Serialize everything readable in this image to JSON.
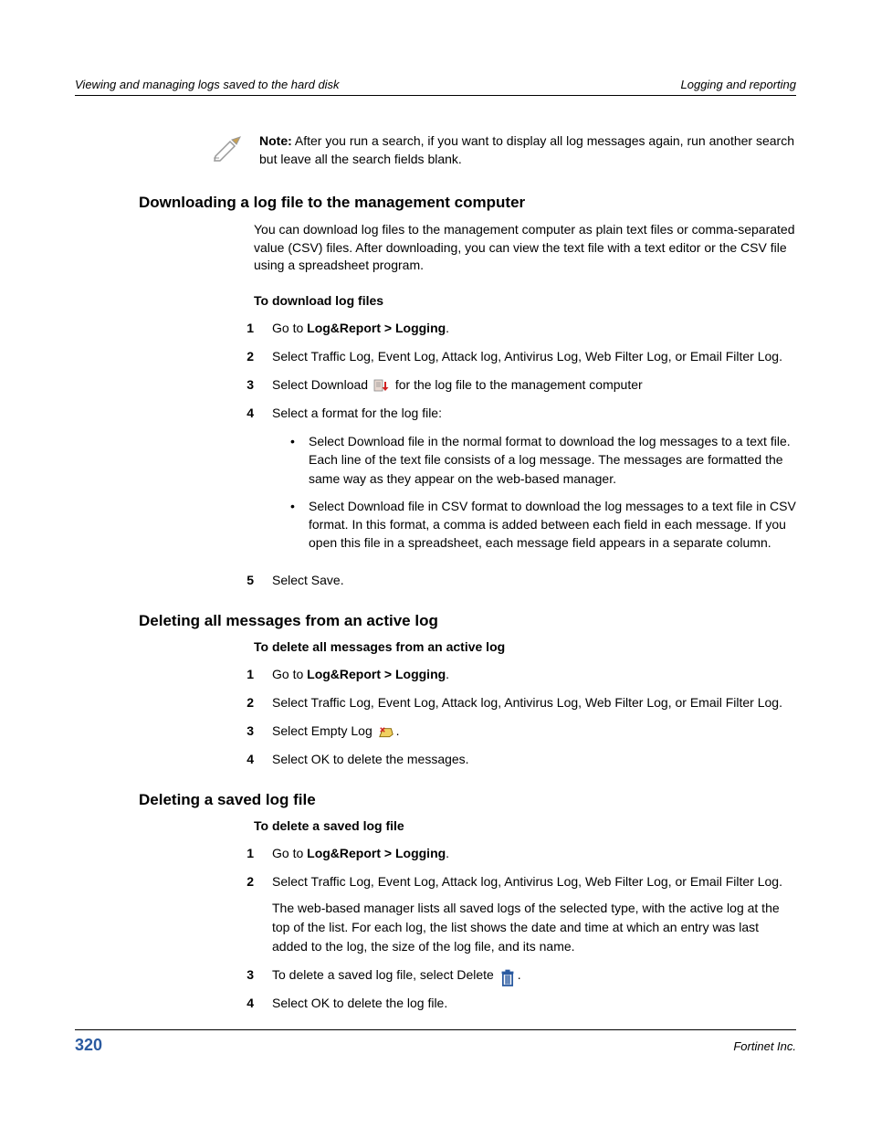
{
  "header": {
    "left": "Viewing and managing logs saved to the hard disk",
    "right": "Logging and reporting"
  },
  "note": {
    "label": "Note:",
    "text": " After you run a search, if you want to display all log messages again, run another search but leave all the search fields blank."
  },
  "section1": {
    "title": "Downloading a log file to the management computer",
    "intro": "You can download log files to the management computer as plain text files or comma-separated value (CSV) files. After downloading, you can view the text file with a text editor or the CSV file using a spreadsheet program.",
    "sub": "To download log files",
    "steps": {
      "s1_a": "Go to ",
      "s1_b": "Log&Report > Logging",
      "s1_c": ".",
      "s2": "Select Traffic Log, Event Log, Attack log, Antivirus Log, Web Filter Log, or Email Filter Log.",
      "s3_a": "Select Download ",
      "s3_b": " for the log file to the management computer",
      "s4": "Select a format for the log file:",
      "s4_b1": "Select Download file in the normal format to download the log messages to a text file. Each line of the text file consists of a log message. The messages are formatted the same way as they appear on the web-based manager.",
      "s4_b2": "Select Download file in CSV format to download the log messages to a text file in CSV format. In this format, a comma is added between each field in each message. If you open this file in a spreadsheet, each message field appears in a separate column.",
      "s5": "Select Save."
    }
  },
  "section2": {
    "title": "Deleting all messages from an active log",
    "sub": "To delete all messages from an active log",
    "steps": {
      "s1_a": "Go to ",
      "s1_b": "Log&Report > Logging",
      "s1_c": ".",
      "s2": "Select Traffic Log, Event Log, Attack log, Antivirus Log, Web Filter Log, or Email Filter Log.",
      "s3_a": "Select Empty Log ",
      "s3_c": ".",
      "s4": "Select OK to delete the messages."
    }
  },
  "section3": {
    "title": "Deleting a saved log file",
    "sub": "To delete a saved log file",
    "steps": {
      "s1_a": "Go to ",
      "s1_b": "Log&Report > Logging",
      "s1_c": ".",
      "s2": "Select Traffic Log, Event Log, Attack log, Antivirus Log, Web Filter Log, or Email Filter Log.",
      "s2_extra": "The web-based manager lists all saved logs of the selected type, with the active log at the top of the list. For each log, the list shows the date and time at which an entry was last added to the log, the size of the log file, and its name.",
      "s3_a": "To delete a saved log file, select Delete ",
      "s3_c": ".",
      "s4": "Select OK to delete the log file."
    }
  },
  "footer": {
    "page": "320",
    "right": "Fortinet Inc."
  }
}
